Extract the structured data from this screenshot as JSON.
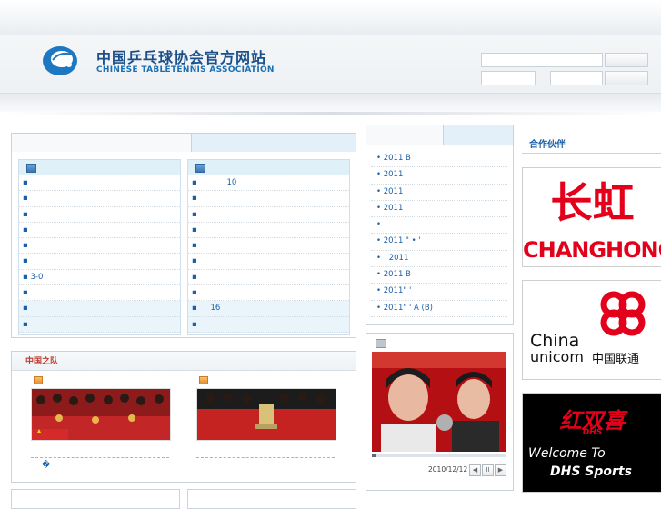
{
  "site": {
    "title_cn": "中国乒乓球协会官方网站",
    "title_en": "CHINESE TABLETENNIS ASSOCIATION"
  },
  "left_lists": {
    "col1": [
      "",
      "",
      "",
      "",
      "",
      "",
      "3-0",
      "",
      "",
      ""
    ],
    "col2": [
      "10",
      "",
      "",
      "",
      "",
      "",
      "",
      "",
      "16",
      ""
    ]
  },
  "news_feed": [
    "2011 B",
    "2011",
    "2011",
    "2011",
    "",
    "2011 \" • '",
    "2011",
    "2011 B",
    "2011\" '",
    "2011\" ' A (B)"
  ],
  "team_section": {
    "title": "中国之队",
    "caption": "�"
  },
  "video": {
    "date": "2010/12/12",
    "controls": [
      "◀",
      "II",
      "▶"
    ]
  },
  "partners": {
    "title": "合作伙伴",
    "ads": [
      {
        "name": "CHANGHONG",
        "cn": "长虹",
        "color": "#e3001b"
      },
      {
        "name_a": "China",
        "name_b": "unicom",
        "cn": "中国联通",
        "color": "#e3001b"
      },
      {
        "brand": "红双喜",
        "sub": "DHS",
        "welcome": "Welcome To",
        "line2": "DHS Sports"
      }
    ]
  },
  "colors": {
    "accent": "#1a5fa8",
    "red": "#c0392b"
  }
}
